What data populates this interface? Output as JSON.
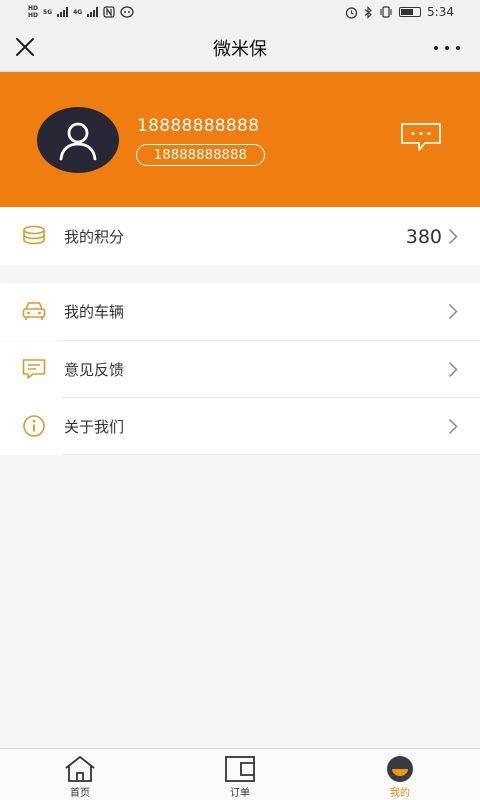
{
  "status_bar": {
    "hd1": "HD",
    "hd2": "HD",
    "net1": "5G",
    "net2": "4G",
    "time": "5:34"
  },
  "nav": {
    "title": "微米保"
  },
  "profile": {
    "phone": "18888888888",
    "phone_tag": "18888888888"
  },
  "menu": {
    "points": {
      "label": "我的积分",
      "value": "380"
    },
    "items": [
      {
        "label": "我的车辆"
      },
      {
        "label": "意见反馈"
      },
      {
        "label": "关于我们"
      }
    ]
  },
  "tabs": [
    {
      "label": "首页"
    },
    {
      "label": "订单"
    },
    {
      "label": "我的"
    }
  ],
  "colors": {
    "accent": "#ef7d10",
    "icon": "#d89a2c",
    "avatar_bg": "#272735"
  }
}
